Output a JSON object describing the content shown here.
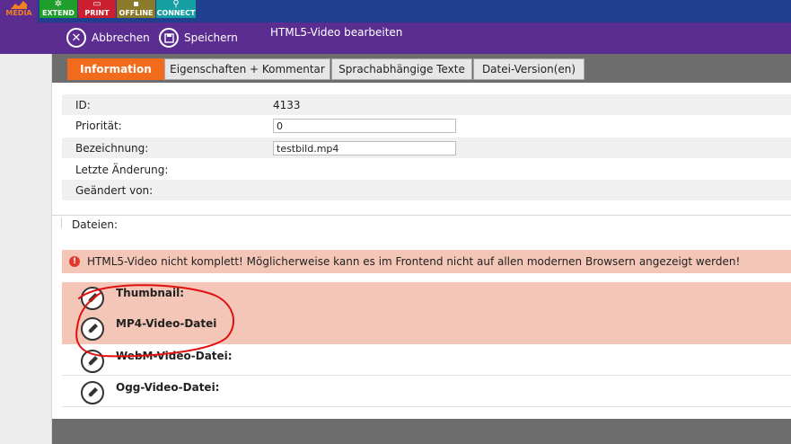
{
  "toolbar": {
    "items": [
      {
        "label": "MEDIA",
        "icon": "chart-icon"
      },
      {
        "label": "EXTEND",
        "icon": "gear-icon"
      },
      {
        "label": "PRINT",
        "icon": "printer-icon"
      },
      {
        "label": "OFFLINE",
        "icon": "disk-icon"
      },
      {
        "label": "CONNECT",
        "icon": "search-icon"
      }
    ]
  },
  "actions": {
    "cancel_label": "Abbrechen",
    "save_label": "Speichern",
    "title": "HTML5-Video bearbeiten"
  },
  "tabs": [
    {
      "label": "Information",
      "active": true
    },
    {
      "label": "Eigenschaften + Kommentar",
      "active": false
    },
    {
      "label": "Sprachabhängige Texte",
      "active": false
    },
    {
      "label": "Datei-Version(en)",
      "active": false
    }
  ],
  "info": {
    "id_label": "ID:",
    "id_value": "4133",
    "priority_label": "Priorität:",
    "priority_value": "0",
    "name_label": "Bezeichnung:",
    "name_value": "testbild.mp4",
    "last_change_label": "Letzte Änderung:",
    "changed_by_label": "Geändert von:"
  },
  "files": {
    "section_label": "Dateien:",
    "warning": "HTML5-Video nicht komplett! Möglicherweise kann es im Frontend nicht auf allen modernen Browsern angezeigt werden!",
    "items": [
      {
        "label": "Thumbnail:",
        "missing": true
      },
      {
        "label": "MP4-Video-Datei",
        "missing": true
      },
      {
        "label": "WebM-Video-Datei:",
        "missing": false
      },
      {
        "label": "Ogg-Video-Datei:",
        "missing": false
      }
    ]
  },
  "colors": {
    "accent": "#f26a1b",
    "header": "#5c2d91",
    "topbar": "#1f3f8f",
    "warning_bg": "#f3c6b7",
    "annotation": "#e01010"
  }
}
